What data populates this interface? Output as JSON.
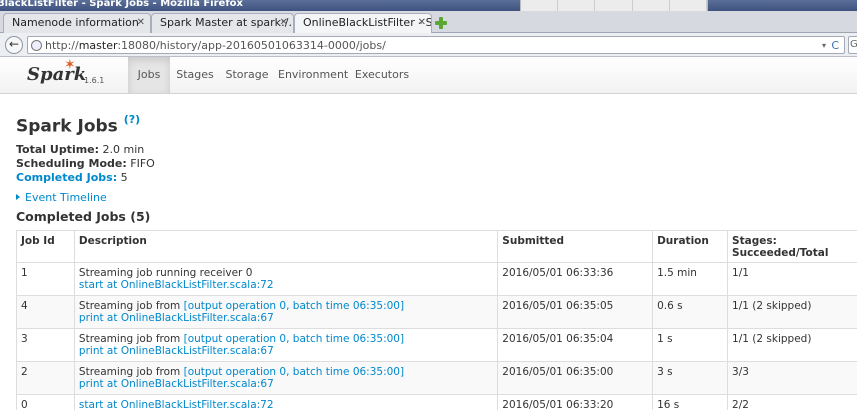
{
  "window": {
    "title": "BlackListFilter - Spark Jobs - Mozilla Firefox"
  },
  "ime": {
    "items": [
      "",
      "",
      "",
      "",
      ""
    ]
  },
  "tabs": [
    {
      "label": "Namenode information",
      "close": "✕"
    },
    {
      "label": "Spark Master at spark:/...",
      "close": "✕"
    },
    {
      "label": "OnlineBlackListFilter - S...",
      "close": "✕"
    }
  ],
  "nav": {
    "back": "←",
    "url_prefix": "http://",
    "url_host": "master",
    "url_rest": ":18080/history/app-20160501063314-0000/jobs/",
    "dropdown": "▾",
    "reload": "C",
    "search_stub": "G"
  },
  "spark": {
    "logo": "Spark",
    "version": "1.6.1",
    "nav_items": [
      "Jobs",
      "Stages",
      "Storage",
      "Environment",
      "Executors"
    ]
  },
  "page": {
    "title": "Spark Jobs",
    "help": "(?)",
    "uptime_label": "Total Uptime:",
    "uptime_value": "2.0 min",
    "mode_label": "Scheduling Mode:",
    "mode_value": "FIFO",
    "completed_label": "Completed Jobs:",
    "completed_value": "5",
    "event_timeline": "Event Timeline",
    "section_title": "Completed Jobs (5)"
  },
  "table": {
    "headers": [
      "Job Id",
      "Description",
      "Submitted",
      "Duration",
      "Stages: Succeeded/Total"
    ],
    "rows": [
      {
        "id": "1",
        "desc_text": "Streaming job running receiver 0",
        "desc_link": "",
        "desc_sub": "start at OnlineBlackListFilter.scala:72",
        "submitted": "2016/05/01 06:33:36",
        "duration": "1.5 min",
        "stages": "1/1"
      },
      {
        "id": "4",
        "desc_text": "Streaming job from ",
        "desc_link": "[output operation 0, batch time 06:35:00]",
        "desc_sub": "print at OnlineBlackListFilter.scala:67",
        "submitted": "2016/05/01 06:35:05",
        "duration": "0.6 s",
        "stages": "1/1 (2 skipped)"
      },
      {
        "id": "3",
        "desc_text": "Streaming job from ",
        "desc_link": "[output operation 0, batch time 06:35:00]",
        "desc_sub": "print at OnlineBlackListFilter.scala:67",
        "submitted": "2016/05/01 06:35:04",
        "duration": "1 s",
        "stages": "1/1 (2 skipped)"
      },
      {
        "id": "2",
        "desc_text": "Streaming job from ",
        "desc_link": "[output operation 0, batch time 06:35:00]",
        "desc_sub": "print at OnlineBlackListFilter.scala:67",
        "submitted": "2016/05/01 06:35:00",
        "duration": "3 s",
        "stages": "3/3"
      },
      {
        "id": "0",
        "desc_text": "",
        "desc_link": "",
        "desc_sub": "start at OnlineBlackListFilter.scala:72",
        "submitted": "2016/05/01 06:33:20",
        "duration": "16 s",
        "stages": "2/2"
      }
    ]
  }
}
